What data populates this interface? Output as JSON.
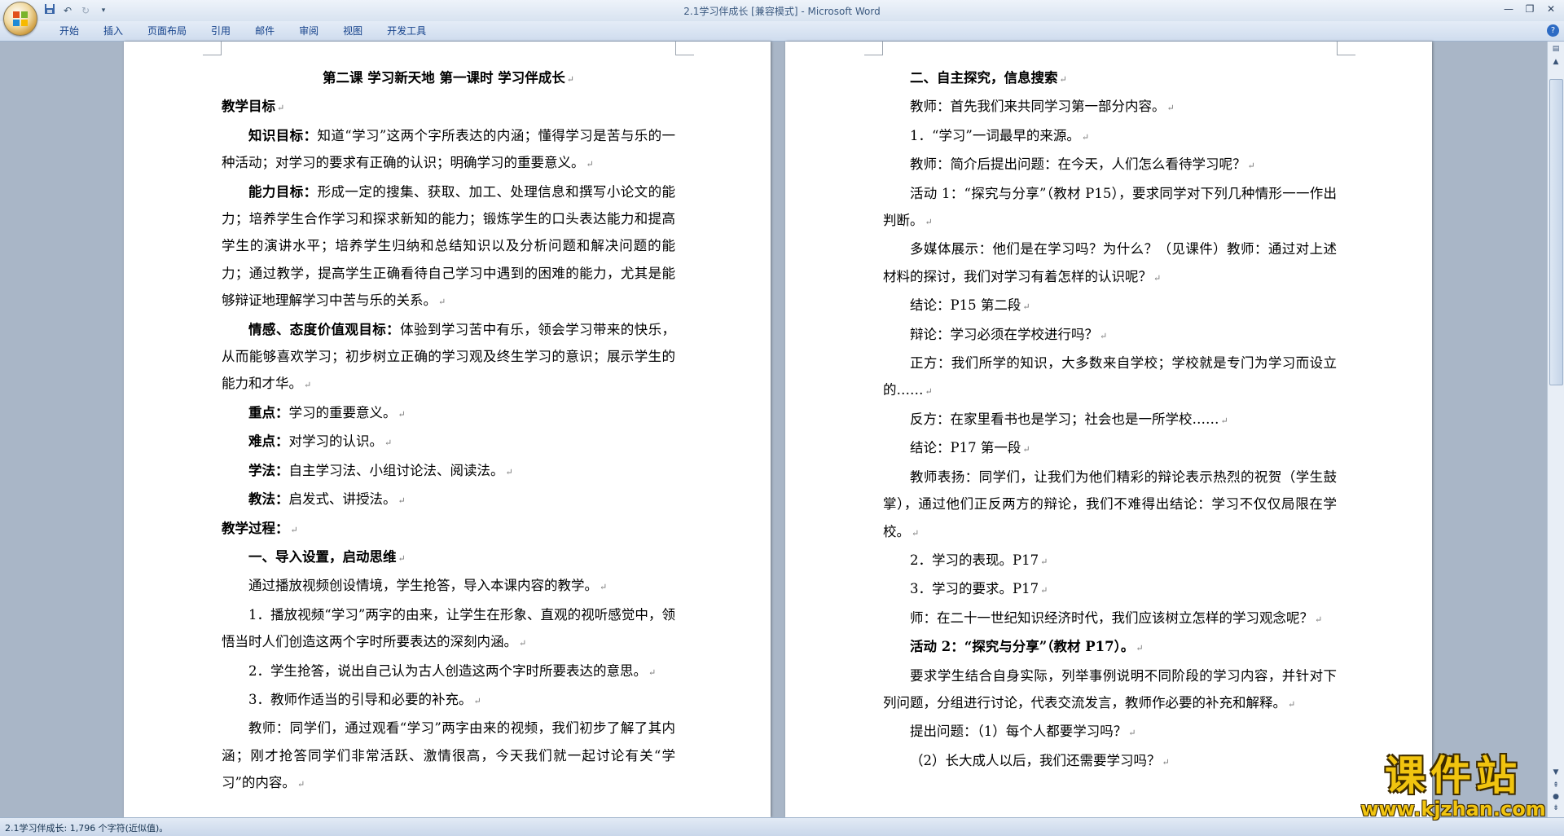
{
  "window": {
    "title": "2.1学习伴成长 [兼容模式] - Microsoft Word",
    "controls": [
      "minimize-icon",
      "restore-icon",
      "close-icon"
    ]
  },
  "quick_access": [
    "save-icon",
    "undo-icon",
    "redo-icon",
    "dropdown-icon"
  ],
  "ribbon": {
    "tabs": [
      "开始",
      "插入",
      "页面布局",
      "引用",
      "邮件",
      "审阅",
      "视图",
      "开发工具"
    ]
  },
  "page1": {
    "paragraphs": [
      {
        "style": "center",
        "bold": "第二课  学习新天地  第一课时  学习伴成长",
        "text": ""
      },
      {
        "style": "plain",
        "bold": "教学目标",
        "text": ""
      },
      {
        "style": "indent",
        "bold": "知识目标：",
        "text": "知道“学习”这两个字所表达的内涵；懂得学习是苦与乐的一种活动；对学习的要求有正确的认识；明确学习的重要意义。"
      },
      {
        "style": "indent",
        "bold": "能力目标：",
        "text": "形成一定的搜集、获取、加工、处理信息和撰写小论文的能力；培养学生合作学习和探求新知的能力；锻炼学生的口头表达能力和提高学生的演讲水平；培养学生归纳和总结知识以及分析问题和解决问题的能力；通过教学，提高学生正确看待自己学习中遇到的困难的能力，尤其是能够辩证地理解学习中苦与乐的关系。"
      },
      {
        "style": "indent",
        "bold": "情感、态度价值观目标：",
        "text": "体验到学习苦中有乐，领会学习带来的快乐，从而能够喜欢学习；初步树立正确的学习观及终生学习的意识；展示学生的能力和才华。"
      },
      {
        "style": "indent",
        "bold": "重点：",
        "text": "学习的重要意义。"
      },
      {
        "style": "indent",
        "bold": "难点：",
        "text": "对学习的认识。"
      },
      {
        "style": "indent",
        "bold": "学法：",
        "text": "自主学习法、小组讨论法、阅读法。"
      },
      {
        "style": "indent",
        "bold": "教法：",
        "text": "启发式、讲授法。"
      },
      {
        "style": "plain",
        "bold": "教学过程：",
        "text": ""
      },
      {
        "style": "indent",
        "bold": "一、导入设置，启动思维",
        "text": ""
      },
      {
        "style": "indent",
        "bold": "",
        "text": "通过播放视频创设情境，学生抢答，导入本课内容的教学。"
      },
      {
        "style": "indent",
        "bold": "",
        "text": "1．播放视频“学习”两字的由来，让学生在形象、直观的视听感觉中，领悟当时人们创造这两个字时所要表达的深刻内涵。"
      },
      {
        "style": "indent",
        "bold": "",
        "text": "2．学生抢答，说出自己认为古人创造这两个字时所要表达的意思。"
      },
      {
        "style": "indent",
        "bold": "",
        "text": "3．教师作适当的引导和必要的补充。"
      },
      {
        "style": "indent",
        "bold": "",
        "text": "教师：同学们，通过观看“学习”两字由来的视频，我们初步了解了其内涵；刚才抢答同学们非常活跃、激情很高，今天我们就一起讨论有关“学习”的内容。"
      }
    ]
  },
  "page2": {
    "paragraphs": [
      {
        "style": "indent",
        "bold": "二、自主探究，信息搜索",
        "text": ""
      },
      {
        "style": "indent",
        "bold": "",
        "text": "教师：首先我们来共同学习第一部分内容。"
      },
      {
        "style": "indent",
        "bold": "",
        "text": "1．“学习”一词最早的来源。"
      },
      {
        "style": "indent",
        "bold": "",
        "text": "教师：简介后提出问题：在今天，人们怎么看待学习呢？"
      },
      {
        "style": "indent",
        "bold": "",
        "text": "活动 1：“探究与分享”（教材 P15），要求同学对下列几种情形一一作出判断。"
      },
      {
        "style": "indent",
        "bold": "",
        "text": "多媒体展示：他们是在学习吗？为什么？（见课件）教师：通过对上述材料的探讨，我们对学习有着怎样的认识呢？"
      },
      {
        "style": "indent",
        "bold": "",
        "text": "结论：P15 第二段"
      },
      {
        "style": "indent",
        "bold": "",
        "text": "辩论：学习必须在学校进行吗？"
      },
      {
        "style": "indent",
        "bold": "",
        "text": "正方：我们所学的知识，大多数来自学校；学校就是专门为学习而设立的……"
      },
      {
        "style": "indent",
        "bold": "",
        "text": "反方：在家里看书也是学习；社会也是一所学校……"
      },
      {
        "style": "indent",
        "bold": "",
        "text": "结论：P17 第一段"
      },
      {
        "style": "indent",
        "bold": "",
        "text": "教师表扬：同学们，让我们为他们精彩的辩论表示热烈的祝贺（学生鼓掌），通过他们正反两方的辩论，我们不难得出结论：学习不仅仅局限在学校。"
      },
      {
        "style": "indent",
        "bold": "",
        "text": "2．学习的表现。P17"
      },
      {
        "style": "indent",
        "bold": "",
        "text": "3．学习的要求。P17"
      },
      {
        "style": "indent",
        "bold": "",
        "text": "师：在二十一世纪知识经济时代，我们应该树立怎样的学习观念呢？"
      },
      {
        "style": "indent",
        "bold": "活动 2：“探究与分享”（教材 P17）。",
        "text": ""
      },
      {
        "style": "indent",
        "bold": "",
        "text": "要求学生结合自身实际，列举事例说明不同阶段的学习内容，并针对下列问题，分组进行讨论，代表交流发言，教师作必要的补充和解释。"
      },
      {
        "style": "indent",
        "bold": "",
        "text": "提出问题：（1）每个人都要学习吗？"
      },
      {
        "style": "indent",
        "bold": "",
        "text": "（2）长大成人以后，我们还需要学习吗？"
      }
    ]
  },
  "paragraph_mark": "↵",
  "status_bar": {
    "text": "2.1学习伴成长: 1,796 个字符(近似值)。"
  },
  "watermark": {
    "main": "课件站",
    "url": "www.kjzhan.com"
  },
  "colors": {
    "workspace": "#a9b6c7",
    "tab_text": "#15428b",
    "watermark": "#f1c40f"
  }
}
